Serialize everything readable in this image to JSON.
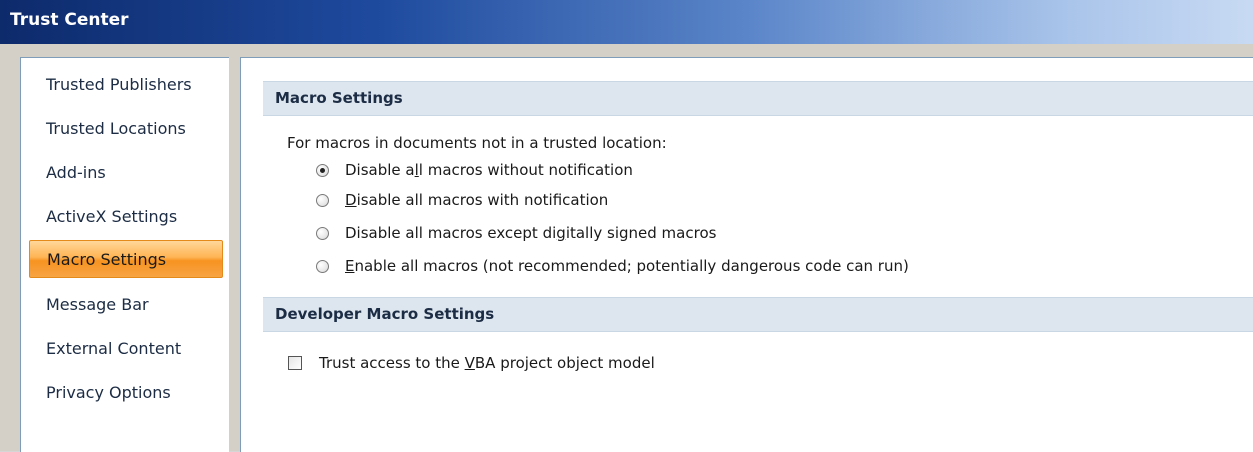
{
  "window": {
    "title": "Trust Center"
  },
  "sidebar": {
    "items": [
      {
        "label": "Trusted Publishers",
        "selected": false
      },
      {
        "label": "Trusted Locations",
        "selected": false
      },
      {
        "label": "Add-ins",
        "selected": false
      },
      {
        "label": "ActiveX Settings",
        "selected": false
      },
      {
        "label": "Macro Settings",
        "selected": true
      },
      {
        "label": "Message Bar",
        "selected": false
      },
      {
        "label": "External Content",
        "selected": false
      },
      {
        "label": "Privacy Options",
        "selected": false
      }
    ]
  },
  "main": {
    "macro_section": {
      "header": "Macro Settings",
      "description": "For macros in documents not in a trusted location:",
      "options": [
        {
          "pre": "Disable a",
          "ul": "l",
          "post": "l macros without notification",
          "checked": true
        },
        {
          "pre": "",
          "ul": "D",
          "post": "isable all macros with notification",
          "checked": false
        },
        {
          "pre": "Disable all macros except di",
          "ul": "g",
          "post": "itally signed macros",
          "checked": false
        },
        {
          "pre": "",
          "ul": "E",
          "post": "nable all macros (not recommended; potentially dangerous code can run)",
          "checked": false
        }
      ]
    },
    "developer_section": {
      "header": "Developer Macro Settings",
      "checkbox": {
        "pre": "Trust access to the ",
        "ul": "V",
        "post": "BA project object model",
        "checked": false
      }
    }
  },
  "colors": {
    "selected_item": "#f79321",
    "section_header_bg": "#dde6ef",
    "titlebar_start": "#0d2a6b"
  }
}
